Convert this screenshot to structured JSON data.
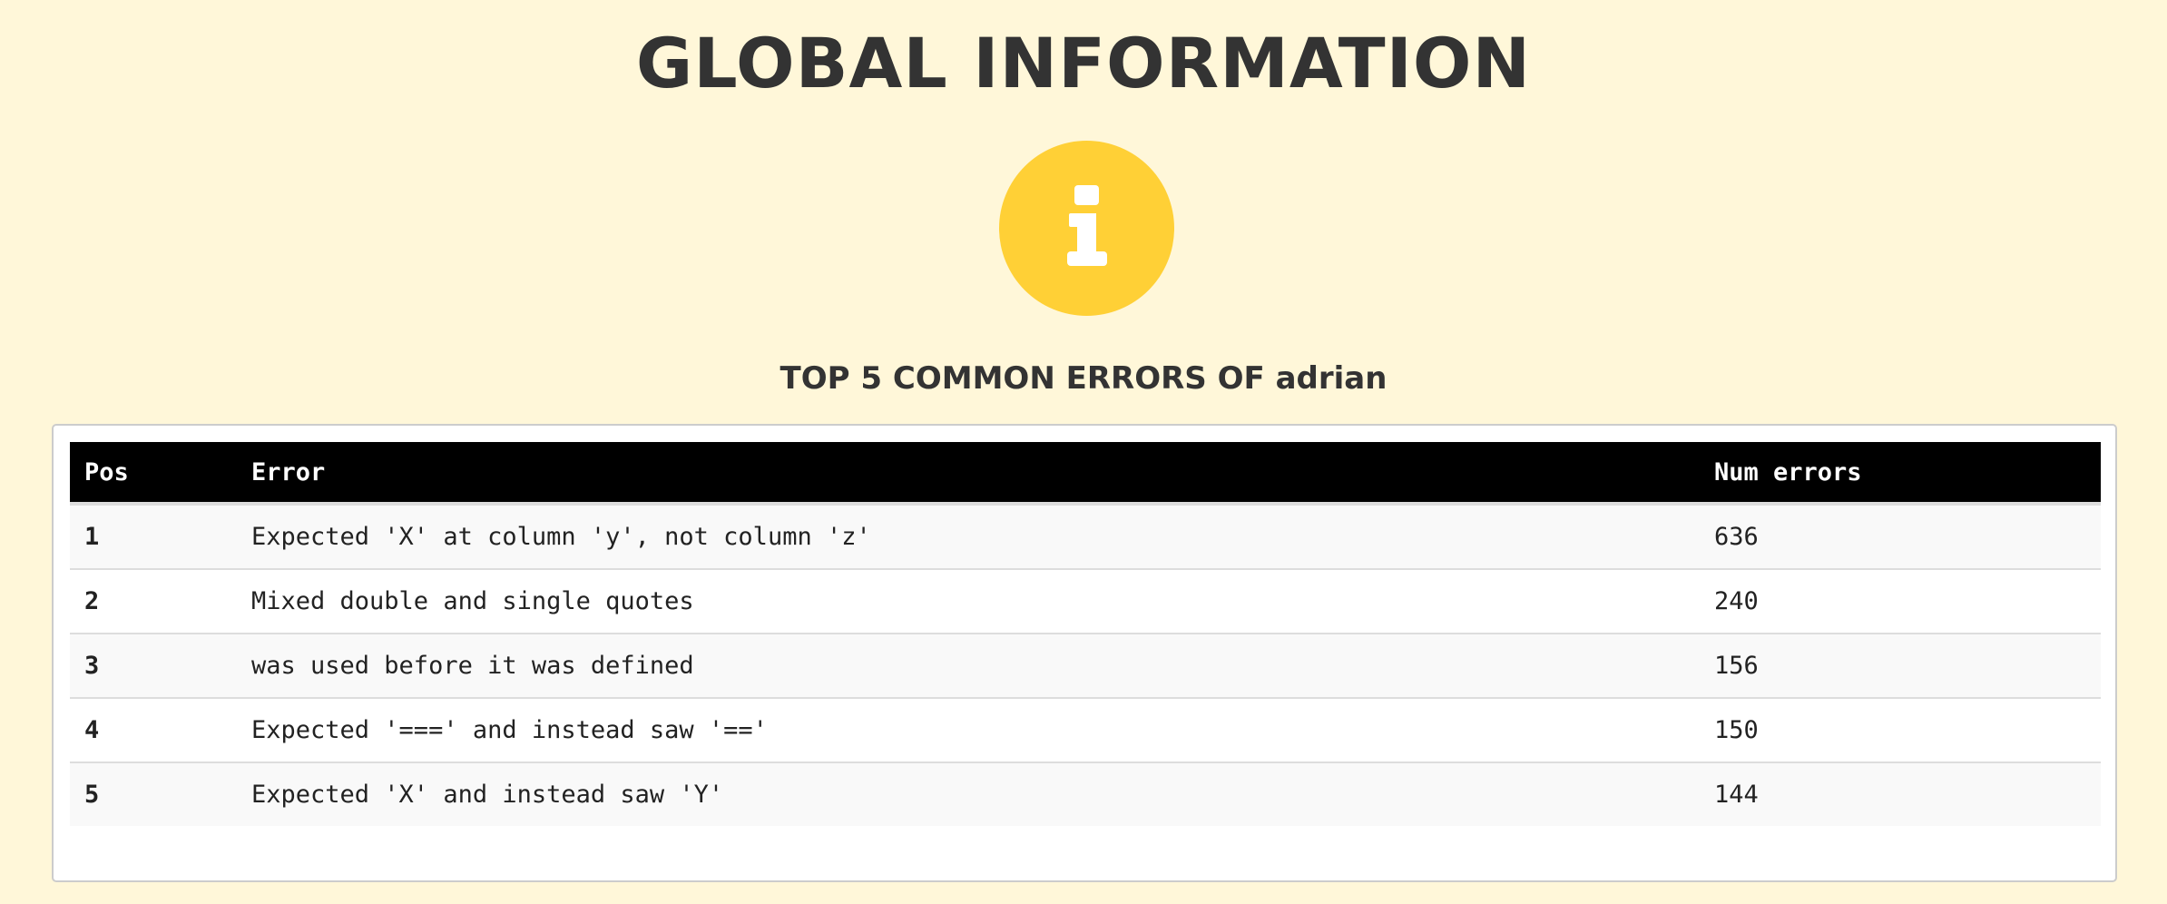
{
  "header": {
    "title": "GLOBAL INFORMATION",
    "icon": "info-icon",
    "icon_color": "#ffd036",
    "subtitle": "TOP 5 COMMON ERRORS OF adrian"
  },
  "table": {
    "columns": [
      "Pos",
      "Error",
      "Num errors"
    ],
    "rows": [
      {
        "pos": "1",
        "error": "Expected 'X' at column 'y', not column 'z'",
        "count": "636"
      },
      {
        "pos": "2",
        "error": "Mixed double and single quotes",
        "count": "240"
      },
      {
        "pos": "3",
        "error": "was used before it was defined",
        "count": "156"
      },
      {
        "pos": "4",
        "error": "Expected '===' and instead saw '=='",
        "count": "150"
      },
      {
        "pos": "5",
        "error": "Expected 'X' and instead saw 'Y'",
        "count": "144"
      }
    ]
  }
}
